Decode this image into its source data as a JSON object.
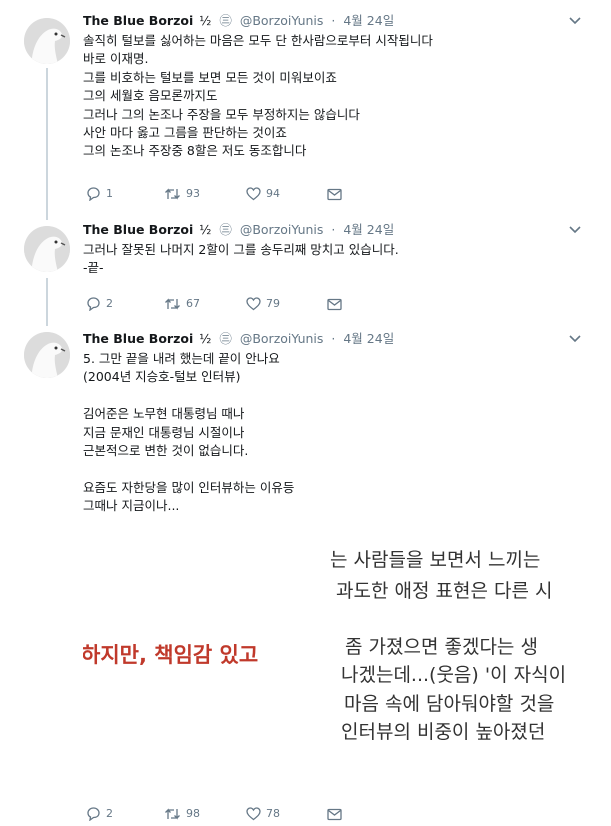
{
  "tweets": [
    {
      "name": "The Blue Borzoi",
      "badge": "½",
      "badge2": "㊂",
      "handle": "@BorzoiYunis",
      "dot": "·",
      "date": "4월 24일",
      "lines": [
        "솔직히 털보를 싫어하는 마음은 모두 단 한사람으로부터 시작됩니다",
        "바로 이재명.",
        "그를 비호하는 털보를 보면 모든 것이 미워보이죠",
        "그의 세월호 음모론까지도",
        "그러나 그의 논조나 주장을 모두 부정하지는 않습니다",
        "사안 마다 옳고 그름을 판단하는 것이죠",
        "그의 논조나 주장중 8할은 저도 동조합니다"
      ],
      "replies": "1",
      "retweets": "93",
      "likes": "94"
    },
    {
      "name": "The Blue Borzoi",
      "badge": "½",
      "badge2": "㊂",
      "handle": "@BorzoiYunis",
      "dot": "·",
      "date": "4월 24일",
      "lines": [
        "그러나 잘못된 나머지 2할이 그를 송두리째 망치고 있습니다.",
        "-끝-"
      ],
      "replies": "2",
      "retweets": "67",
      "likes": "79"
    },
    {
      "name": "The Blue Borzoi",
      "badge": "½",
      "badge2": "㊂",
      "handle": "@BorzoiYunis",
      "dot": "·",
      "date": "4월 24일",
      "lines": [
        "5. 그만 끝을 내려 했는데 끝이 안나요",
        "(2004년 지승호-털보 인터뷰)",
        "",
        "김어준은 노무현 대통령님 때나",
        "지금 문재인 대통령님 시절이나",
        "근본적으로 변한 것이 없습니다.",
        "",
        "요즘도 자한당을 많이 인터뷰하는 이유등",
        "그때나 지금이나..."
      ],
      "replies": "2",
      "retweets": "98",
      "likes": "78"
    }
  ],
  "media_text": {
    "line1": "는 사람들을 보면서 느끼는",
    "line2": "과도한 애정 표현은 다른 시",
    "highlight": "하지만, 책임감 있고",
    "line3": "좀 가졌으면 좋겠다는 생",
    "line4": "나겠는데...(웃음) '이 자식이",
    "line5": "마음 속에 담아둬야할 것을",
    "line6": "인터뷰의 비중이 높아졌던"
  },
  "colors": {
    "text": "#14171a",
    "muted": "#657786",
    "highlight": "#c0392b"
  }
}
